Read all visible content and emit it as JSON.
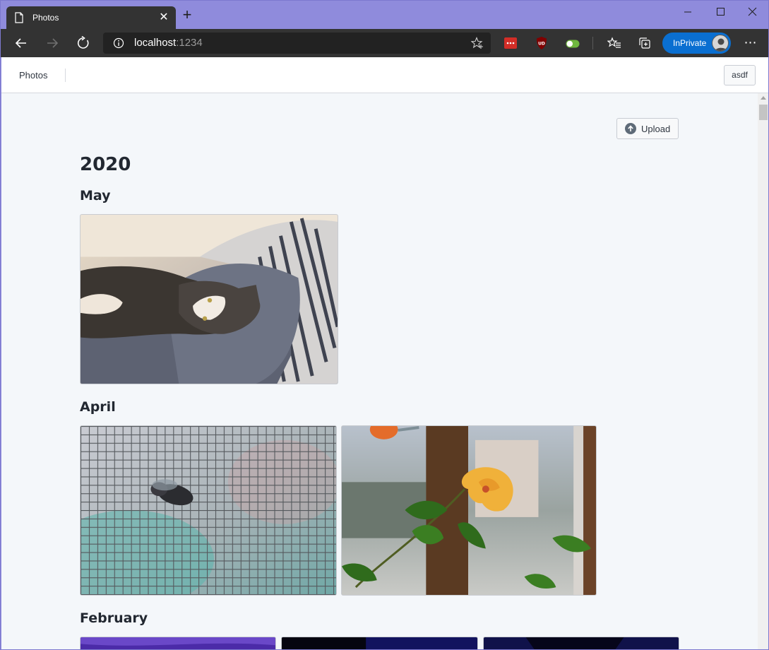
{
  "browser": {
    "tab_title": "Photos",
    "tab_icon": "page-icon",
    "url_host": "localhost",
    "url_port": ":1234",
    "inprivate_label": "InPrivate",
    "window_controls": [
      "minimize",
      "maximize",
      "close"
    ],
    "toolbar_icons": [
      "back-icon",
      "forward-icon",
      "refresh-icon",
      "info-icon",
      "favorite-star-icon",
      "lastpass-icon",
      "ublock-icon",
      "toggle-extension-icon",
      "favorites-list-icon",
      "collections-icon",
      "more-icon"
    ]
  },
  "navbar": {
    "brand": "Photos",
    "user_label": "asdf"
  },
  "upload": {
    "label": "Upload",
    "icon": "upload-arrow-icon"
  },
  "gallery": {
    "year": "2020",
    "months": [
      {
        "label": "May",
        "photos": [
          "cat-on-blanket-photo"
        ]
      },
      {
        "label": "April",
        "photos": [
          "fly-on-screen-photo",
          "hibiscus-window-photo"
        ]
      },
      {
        "label": "February",
        "photos": [
          "purple-abstract-photo",
          "dark-blue-photo",
          "dark-navy-photo"
        ]
      }
    ]
  },
  "colors": {
    "titlebar": "#8f8bdc",
    "toolbar": "#333333",
    "inprivate": "#0a6fd1",
    "page_background": "#f4f7fa"
  }
}
